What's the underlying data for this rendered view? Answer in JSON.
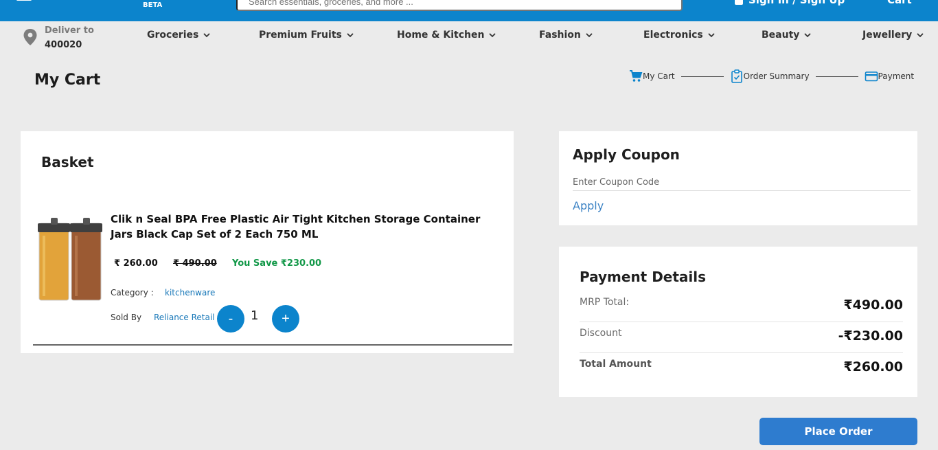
{
  "header": {
    "beta_label": "BETA",
    "search_placeholder": "Search essentials, groceries, and more ...",
    "signin_label": "Sign In / Sign Up",
    "cart_label": "Cart"
  },
  "delivery": {
    "label": "Deliver to",
    "pincode": "400020"
  },
  "nav": {
    "items": [
      {
        "label": "Groceries"
      },
      {
        "label": "Premium Fruits"
      },
      {
        "label": "Home & Kitchen"
      },
      {
        "label": "Fashion"
      },
      {
        "label": "Electronics"
      },
      {
        "label": "Beauty"
      },
      {
        "label": "Jewellery"
      }
    ]
  },
  "page": {
    "title": "My Cart"
  },
  "steps": [
    {
      "label": "My Cart",
      "icon": "cart-icon"
    },
    {
      "label": "Order Summary",
      "icon": "clipboard-check-icon"
    },
    {
      "label": "Payment",
      "icon": "credit-card-icon"
    }
  ],
  "basket": {
    "title": "Basket",
    "item": {
      "name": "Clik n Seal BPA Free Plastic Air Tight Kitchen Storage Container Jars Black Cap Set of 2 Each 750 ML",
      "price": "₹ 260.00",
      "mrp": "₹ 490.00",
      "savings": "You Save ₹230.00",
      "category_label": "Category :",
      "category": "kitchenware",
      "seller_label": "Sold By",
      "seller": "Reliance Retail",
      "quantity": "1",
      "minus_label": "-",
      "plus_label": "+"
    }
  },
  "coupon": {
    "title": "Apply Coupon",
    "placeholder": "Enter Coupon Code",
    "apply_label": "Apply"
  },
  "payment": {
    "title": "Payment Details",
    "rows": [
      {
        "label": "MRP Total:",
        "value": "₹490.00"
      },
      {
        "label": "Discount",
        "value": "-₹230.00"
      },
      {
        "label": "Total Amount",
        "value": "₹260.00"
      }
    ]
  },
  "actions": {
    "place_order_label": "Place Order"
  },
  "colors": {
    "brand_blue": "#0c84cc",
    "savings_green": "#129848",
    "link_blue": "#1777b8",
    "button_blue": "#2e7ccf"
  }
}
